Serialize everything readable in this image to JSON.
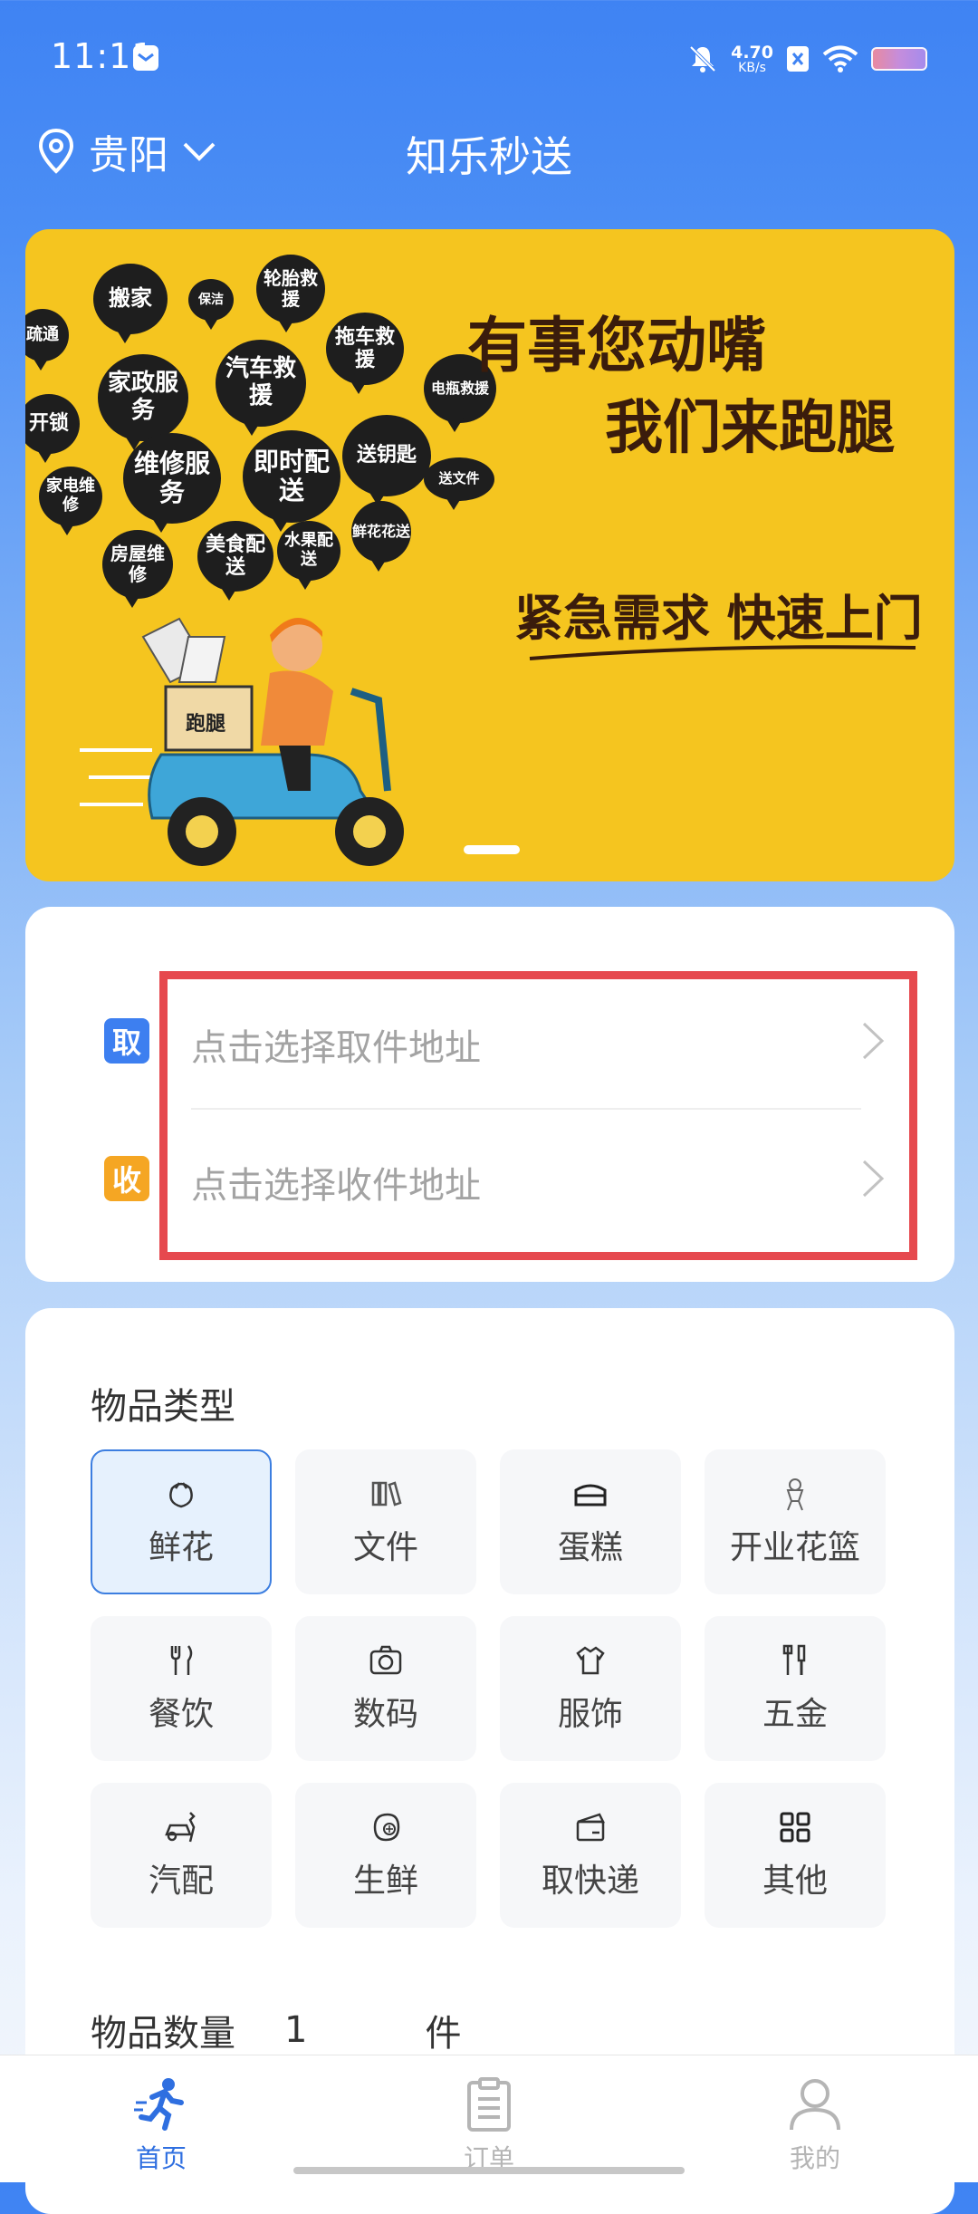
{
  "status_bar": {
    "time": "11:11",
    "net_speed_value": "4.70",
    "net_speed_unit": "KB/s"
  },
  "header": {
    "city": "贵阳",
    "title": "知乐秒送"
  },
  "banner": {
    "bubbles": [
      "搬家",
      "保洁",
      "轮胎救援",
      "疏通",
      "汽车救援",
      "拖车救援",
      "家政服务",
      "电瓶救援",
      "开锁",
      "维修服务",
      "即时配送",
      "送钥匙",
      "家电维修",
      "送文件",
      "鲜花花送",
      "美食配送",
      "水果配送",
      "房屋维修"
    ],
    "slogan_1": "有事您动嘴",
    "slogan_2": "我们来跑腿",
    "slogan_3": "紧急需求 快速上门",
    "scooter_box_label": "跑腿"
  },
  "address": {
    "pickup_badge": "取",
    "pickup_placeholder": "点击选择取件地址",
    "delivery_badge": "收",
    "delivery_placeholder": "点击选择收件地址"
  },
  "category": {
    "title": "物品类型",
    "items": [
      {
        "label": "鲜花",
        "icon": "flower-icon",
        "selected": true
      },
      {
        "label": "文件",
        "icon": "files-icon",
        "selected": false
      },
      {
        "label": "蛋糕",
        "icon": "cake-icon",
        "selected": false
      },
      {
        "label": "开业花篮",
        "icon": "flower-basket-icon",
        "selected": false
      },
      {
        "label": "餐饮",
        "icon": "utensils-icon",
        "selected": false
      },
      {
        "label": "数码",
        "icon": "camera-icon",
        "selected": false
      },
      {
        "label": "服饰",
        "icon": "clothing-icon",
        "selected": false
      },
      {
        "label": "五金",
        "icon": "tools-icon",
        "selected": false
      },
      {
        "label": "汽配",
        "icon": "car-parts-icon",
        "selected": false
      },
      {
        "label": "生鲜",
        "icon": "fresh-food-icon",
        "selected": false
      },
      {
        "label": "取快递",
        "icon": "package-icon",
        "selected": false
      },
      {
        "label": "其他",
        "icon": "grid-icon",
        "selected": false
      }
    ],
    "quantity_label": "物品数量",
    "quantity_value": "1",
    "quantity_unit": "件"
  },
  "bottom_nav": {
    "items": [
      {
        "label": "首页",
        "active": true
      },
      {
        "label": "订单",
        "active": false
      },
      {
        "label": "我的",
        "active": false
      }
    ]
  },
  "colors": {
    "primary": "#3f83f3",
    "banner_bg": "#f5c51f",
    "pickup_badge": "#3d7ff0",
    "delivery_badge": "#f5a623",
    "highlight_outline": "#e6494e",
    "nav_active": "#2f6fe0",
    "nav_inactive": "#b5b5b5"
  }
}
